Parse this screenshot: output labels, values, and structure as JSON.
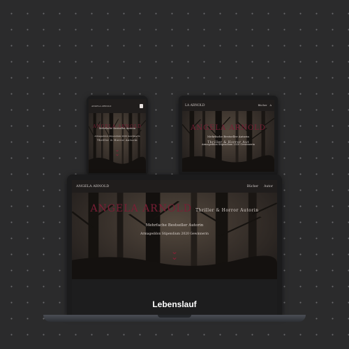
{
  "phone": {
    "logo": "ANGELA ARNOLD",
    "hero_name": "ANGELA ARNOLD",
    "genre": "Thriller & Horror Autorin",
    "line1": "Mehrfache Bestseller Autorin",
    "line2": "Armageddon Stipendium 2020 Gewinnerin"
  },
  "tablet": {
    "logo": "LA ARNOLD",
    "menu": [
      "Bücher",
      "A"
    ],
    "hero_name": "ANGELA ARNOLD",
    "genre": "Thriller & Horror Aut",
    "line1": "Mehrfache Bestseller Autorin",
    "line2": "Armageddon Stipendium 2020 Gewinnerin"
  },
  "laptop": {
    "logo": "ANGELA ARNOLD",
    "menu": [
      "Bücher",
      "Autor"
    ],
    "hero_name": "ANGELA ARNOLD",
    "genre": "Thriller & Horror Autorin",
    "line1": "Mehrfache Bestseller Autorin",
    "line2": "Armageddon Stipendium 2020 Gewinnerin"
  },
  "caption": "Lebenslauf",
  "colors": {
    "accent": "#7a1e35",
    "background": "#2b2b2c",
    "text": "#ddd5d0"
  },
  "icons": {
    "scroll_down": "chevron-double-down-icon",
    "menu": "hamburger-menu-icon"
  }
}
